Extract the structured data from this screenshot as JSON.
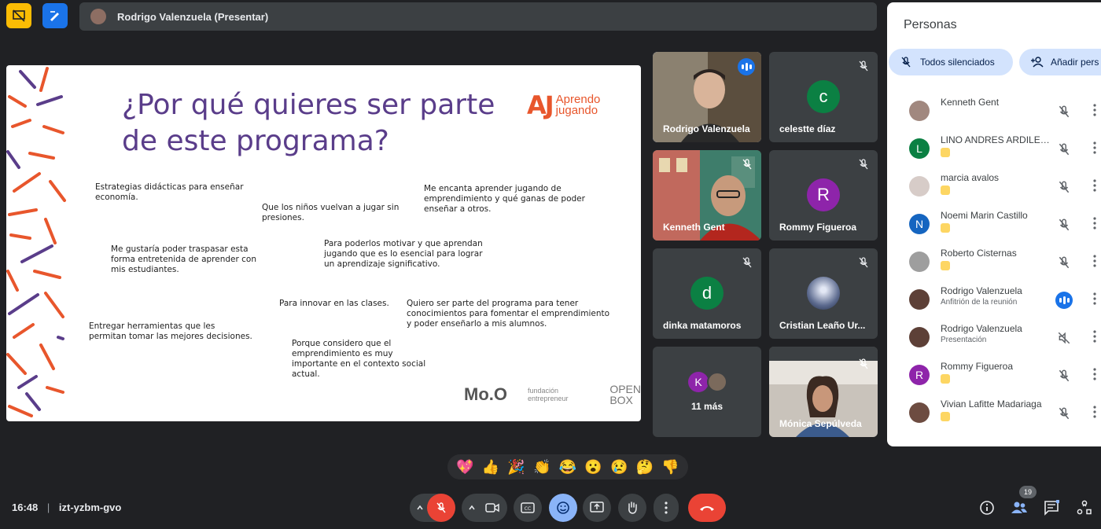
{
  "meeting": {
    "presenter_bar": "Rodrigo Valenzuela (Presentar)",
    "time": "16:48",
    "separator": "|",
    "code": "izt-yzbm-gvo"
  },
  "slide": {
    "title": "¿Por qué quieres ser parte de este programa?",
    "logo_mark": "AJ",
    "logo_text_1": "Aprendo",
    "logo_text_2": "jugando",
    "notes": [
      "Estrategias didácticas para enseñar economía.",
      "Que los niños vuelvan a jugar sin presiones.",
      "Me encanta aprender jugando de emprendimiento y qué ganas de poder enseñar a otros.",
      "Me gustaría poder traspasar esta forma entretenida de aprender con mis estudiantes.",
      "Para poderlos motivar y que aprendan jugando que es lo esencial para lograr un aprendizaje significativo.",
      "Para innovar en las clases.",
      "Quiero ser parte del programa para tener conocimientos para fomentar el emprendimiento y poder enseñarlo a mis alumnos.",
      "Entregar herramientas que les permitan tomar las mejores decisiones.",
      "Porque considero que el emprendimiento es muy importante en el contexto social actual."
    ],
    "sponsors": [
      "Mo.O",
      "fundación entrepreneur",
      "OPEN BOX"
    ]
  },
  "tiles": [
    {
      "name": "Rodrigo Valenzuela",
      "type": "video",
      "active": true
    },
    {
      "name": "celestte díaz",
      "initial": "c",
      "color": "#0b8043"
    },
    {
      "name": "Kenneth Gent",
      "type": "video"
    },
    {
      "name": "Rommy Figueroa",
      "initial": "R",
      "color": "#8e24aa"
    },
    {
      "name": "dinka matamoros",
      "initial": "d",
      "color": "#0b8043"
    },
    {
      "name": "Cristian Leaño Ur...",
      "type": "photo"
    },
    {
      "name": "11 más",
      "initial": "K",
      "color": "#8e24aa"
    },
    {
      "name": "Mónica Sepúlveda",
      "type": "video"
    }
  ],
  "people_panel": {
    "title": "Personas",
    "mute_all": "Todos silenciados",
    "add": "Añadir pers",
    "participants": [
      {
        "name": "Kenneth Gent",
        "avatar": "photo",
        "color": "#a1887f"
      },
      {
        "name": "LINO ANDRES ARDILES ...",
        "initial": "L",
        "color": "#0b8043",
        "badge": true
      },
      {
        "name": "marcia avalos",
        "avatar": "photo",
        "color": "#d7ccc8",
        "badge": true
      },
      {
        "name": "Noemi Marin Castillo",
        "initial": "N",
        "color": "#1565c0",
        "badge": true
      },
      {
        "name": "Roberto Cisternas",
        "avatar": "photo",
        "color": "#9e9e9e",
        "badge": true
      },
      {
        "name": "Rodrigo Valenzuela",
        "sub": "Anfitrión de la reunión",
        "avatar": "photo",
        "color": "#5d4037",
        "speaking": true
      },
      {
        "name": "Rodrigo Valenzuela",
        "sub": "Presentación",
        "avatar": "photo",
        "color": "#5d4037",
        "presenting": true
      },
      {
        "name": "Rommy Figueroa",
        "initial": "R",
        "color": "#8e24aa",
        "badge": true
      },
      {
        "name": "Vivian Lafitte Madariaga",
        "avatar": "photo",
        "color": "#6d4c41",
        "badge": true
      }
    ]
  },
  "reactions": [
    "💖",
    "👍",
    "🎉",
    "👏",
    "😂",
    "😮",
    "😢",
    "🤔",
    "👎"
  ],
  "participant_count": "19"
}
